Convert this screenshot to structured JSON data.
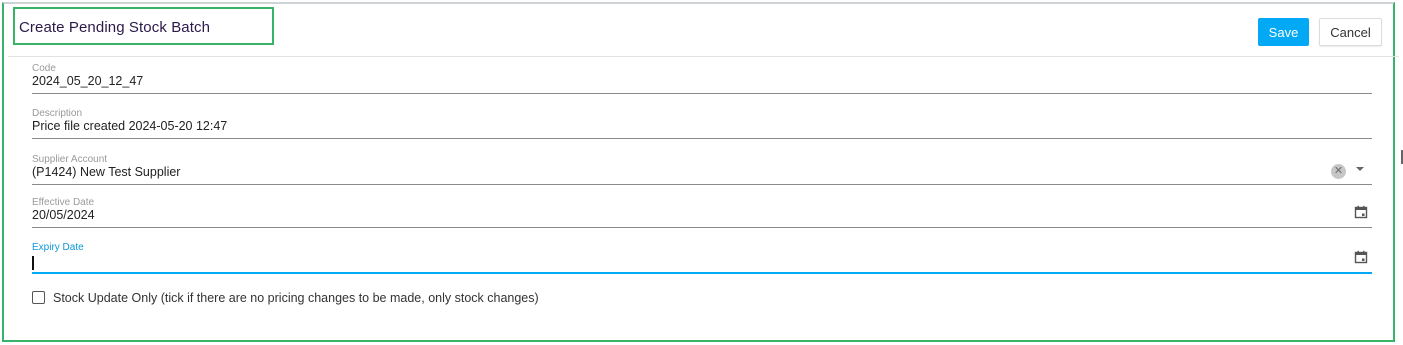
{
  "dialog": {
    "title": "Create Pending Stock Batch",
    "save_label": "Save",
    "cancel_label": "Cancel"
  },
  "fields": {
    "code": {
      "label": "Code",
      "value": "2024_05_20_12_47"
    },
    "description": {
      "label": "Description",
      "value": "Price file created 2024-05-20 12:47"
    },
    "supplier_account": {
      "label": "Supplier Account",
      "value": "(P1424) New Test Supplier"
    },
    "effective_date": {
      "label": "Effective Date",
      "value": "20/05/2024"
    },
    "expiry_date": {
      "label": "Expiry Date",
      "value": ""
    }
  },
  "stock_update_only": {
    "label": "Stock Update Only (tick if there are no pricing changes to be made, only stock changes)",
    "checked": false
  },
  "colors": {
    "accent": "#03a9f4",
    "highlight_border": "#3ab36a"
  },
  "icons": {
    "clear": "clear-icon",
    "dropdown": "chevron-down-icon",
    "calendar": "calendar-icon"
  }
}
